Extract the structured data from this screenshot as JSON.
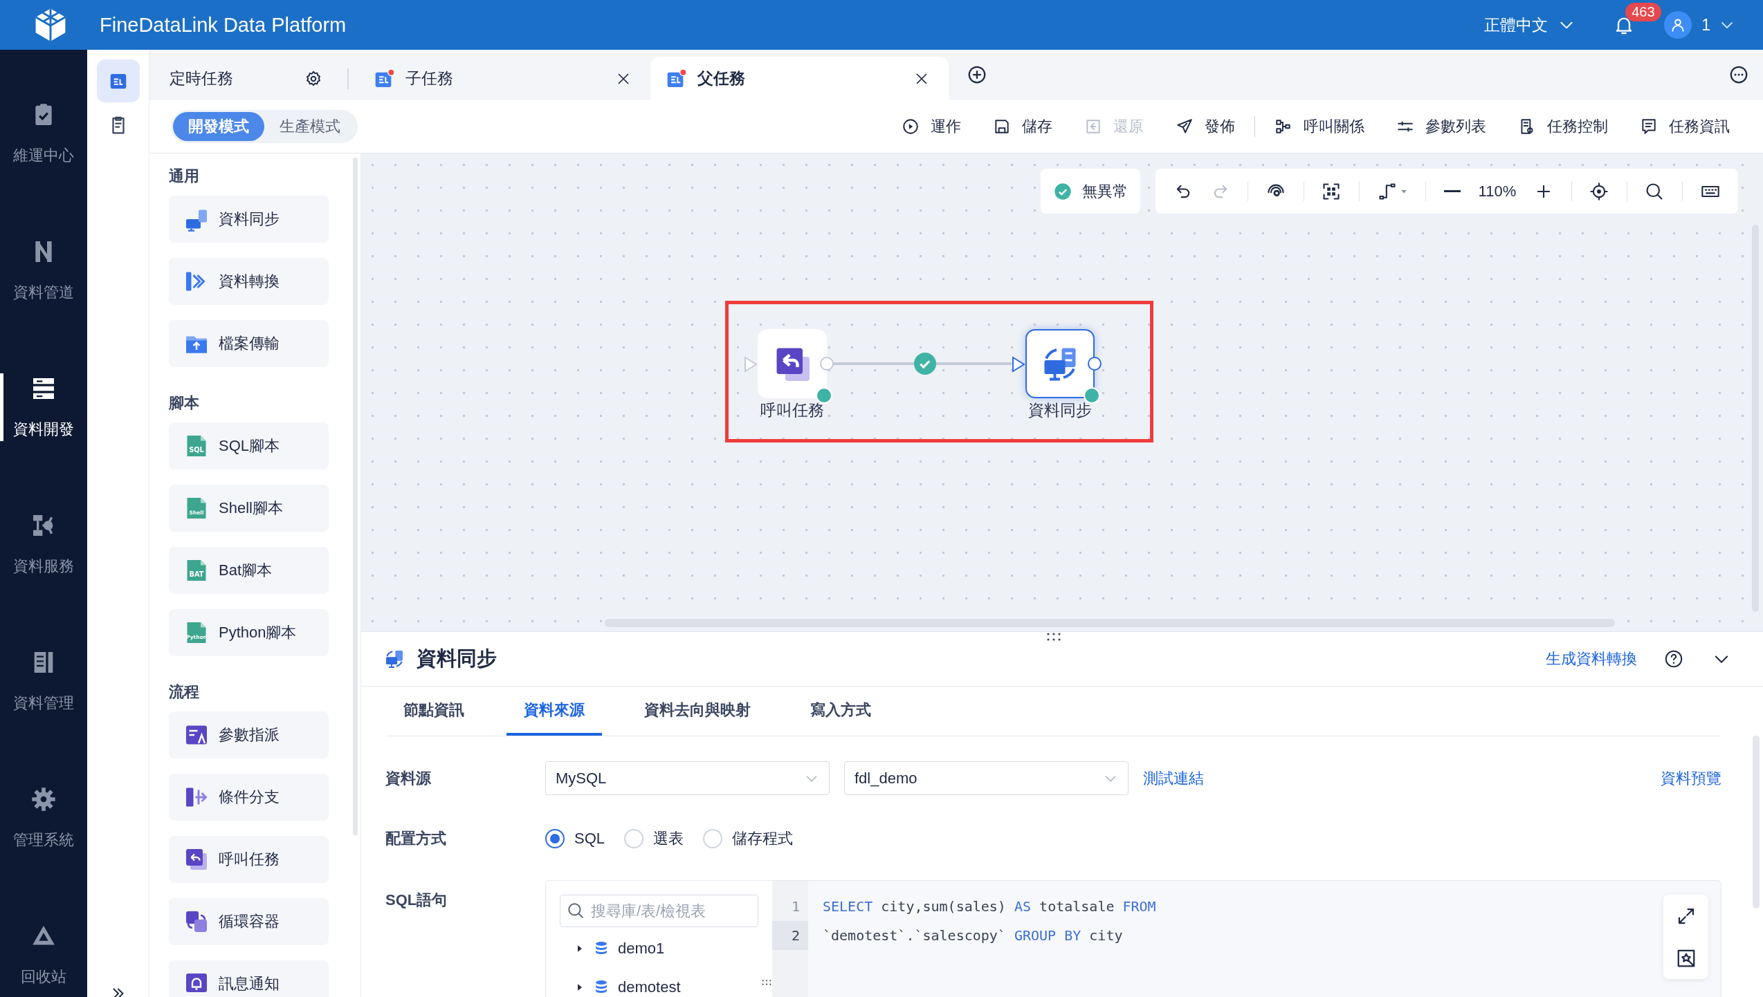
{
  "app_title": "FineDataLink Data Platform",
  "header": {
    "language": "正體中文",
    "notification_count": "463",
    "user": "1"
  },
  "nav": [
    {
      "label": "維運中心",
      "selected": false
    },
    {
      "label": "資料管道",
      "selected": false
    },
    {
      "label": "資料開發",
      "selected": true
    },
    {
      "label": "資料服務",
      "selected": false
    },
    {
      "label": "資料管理",
      "selected": false
    },
    {
      "label": "管理系統",
      "selected": false
    },
    {
      "label": "回收站",
      "selected": false
    }
  ],
  "side_tabs": [
    {
      "selected": true
    },
    {
      "selected": false
    }
  ],
  "tabs": [
    {
      "label": "定時任務",
      "kind": "settings",
      "selected": false,
      "closable": false,
      "modified": false
    },
    {
      "label": "子任務",
      "kind": "task",
      "selected": false,
      "closable": true,
      "modified": true
    },
    {
      "label": "父任務",
      "kind": "task",
      "selected": true,
      "closable": true,
      "modified": true
    }
  ],
  "modes": [
    {
      "label": "開發模式",
      "selected": true
    },
    {
      "label": "生產模式",
      "selected": false
    }
  ],
  "toolbar_actions": [
    {
      "label": "運作",
      "disabled": false
    },
    {
      "label": "儲存",
      "disabled": false
    },
    {
      "label": "還原",
      "disabled": true
    },
    {
      "label": "發佈",
      "disabled": false
    }
  ],
  "toolbar_views": [
    {
      "label": "呼叫關係",
      "disabled": false
    },
    {
      "label": "參數列表",
      "disabled": false
    },
    {
      "label": "任務控制",
      "disabled": false
    },
    {
      "label": "任務資訊",
      "disabled": false
    }
  ],
  "palette": [
    {
      "heading": "通用",
      "items": [
        {
          "label": "資料同步"
        },
        {
          "label": "資料轉換"
        },
        {
          "label": "檔案傳輸"
        }
      ]
    },
    {
      "heading": "腳本",
      "items": [
        {
          "label": "SQL腳本",
          "icon_text": "SQL"
        },
        {
          "label": "Shell腳本",
          "icon_text": "Shell"
        },
        {
          "label": "Bat腳本",
          "icon_text": "BAT"
        },
        {
          "label": "Python腳本",
          "icon_text": "Python"
        }
      ]
    },
    {
      "heading": "流程",
      "items": [
        {
          "label": "參數指派"
        },
        {
          "label": "條件分支"
        },
        {
          "label": "呼叫任務"
        },
        {
          "label": "循環容器"
        },
        {
          "label": "訊息通知"
        }
      ]
    }
  ],
  "canvas": {
    "status": "無異常",
    "zoom": "110%",
    "undo_disabled": false,
    "redo_disabled": true,
    "highlight": true,
    "nodes": [
      {
        "label": "呼叫任務",
        "kind": "call",
        "selected": false,
        "passed": true
      },
      {
        "label": "資料同步",
        "kind": "sync",
        "selected": true,
        "passed": true
      }
    ],
    "edge": {
      "passed": true
    }
  },
  "detail": {
    "title": "資料同步",
    "action_link": "生成資料轉換",
    "tabs": [
      {
        "label": "節點資訊",
        "selected": false
      },
      {
        "label": "資料來源",
        "selected": true
      },
      {
        "label": "資料去向與映射",
        "selected": false
      },
      {
        "label": "寫入方式",
        "selected": false
      }
    ],
    "source_label": "資料源",
    "source_type": "MySQL",
    "source_db": "fdl_demo",
    "test_link": "測試連結",
    "preview_link": "資料預覽",
    "config_label": "配置方式",
    "config_options": [
      {
        "label": "SQL",
        "selected": true
      },
      {
        "label": "選表",
        "selected": false
      },
      {
        "label": "儲存程式",
        "selected": false
      }
    ],
    "sql_label": "SQL語句",
    "search_placeholder": "搜尋庫/表/檢視表",
    "tree": [
      {
        "label": "demo1",
        "expanded": false
      },
      {
        "label": "demotest",
        "expanded": false
      }
    ],
    "code": [
      {
        "number": "1",
        "current": false,
        "tokens": [
          {
            "text": "SELECT",
            "kind": "keyword"
          },
          {
            "text": " city,sum(sales) ",
            "kind": "plain"
          },
          {
            "text": "AS",
            "kind": "keyword"
          },
          {
            "text": " totalsale ",
            "kind": "plain"
          },
          {
            "text": "FROM",
            "kind": "keyword"
          }
        ]
      },
      {
        "number": "2",
        "current": true,
        "tokens": [
          {
            "text": "`demotest`.`salescopy` ",
            "kind": "plain"
          },
          {
            "text": "GROUP BY",
            "kind": "keyword"
          },
          {
            "text": " city",
            "kind": "plain"
          }
        ]
      }
    ]
  }
}
